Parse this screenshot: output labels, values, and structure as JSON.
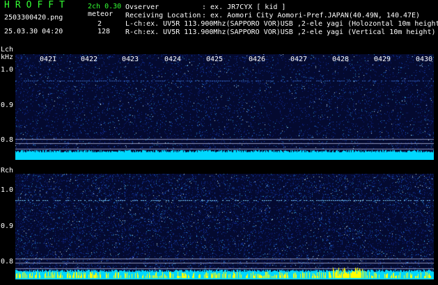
{
  "header": {
    "logo": "HROFFT",
    "version": "2ch 0.30",
    "filename": "2503300420.png",
    "counter_label": "meteor",
    "lch_count": "2",
    "rch_count": "128",
    "datetime": "25.03.30 04:20",
    "observer_label": "Ovserver",
    "observer_value": ": ex. JR7CYX [ kid ]",
    "location_label": "Receiving Location",
    "location_value": ": ex. Aomori City Aomori-Pref.JAPAN(40.49N, 140.47E)",
    "lch_info": "L-ch:ex. UV5R 113.900Mhz(SAPPORO VOR)USB ,2-ele yagi (Holozontal 10m height)",
    "rch_info": "R-ch:ex. UV5R 113.900Mhz(SAPPORO VOR)USB ,2-ele yagi (Vertical 10m height)"
  },
  "time_ticks": [
    "0421",
    "0422",
    "0423",
    "0424",
    "0425",
    "0426",
    "0427",
    "0428",
    "0429",
    "0430"
  ],
  "lch": {
    "label": "Lch",
    "unit": "kHz",
    "y_ticks": [
      "1.0",
      "0.9",
      "0.8"
    ]
  },
  "rch": {
    "label": "Rch",
    "y_ticks": [
      "1.0",
      "0.9",
      "0.8"
    ]
  },
  "colors": {
    "logo": "#33ff33",
    "noise_base": "#050a2e",
    "level_cyan": "#00e0ff",
    "level_yellow": "#ffff00"
  }
}
